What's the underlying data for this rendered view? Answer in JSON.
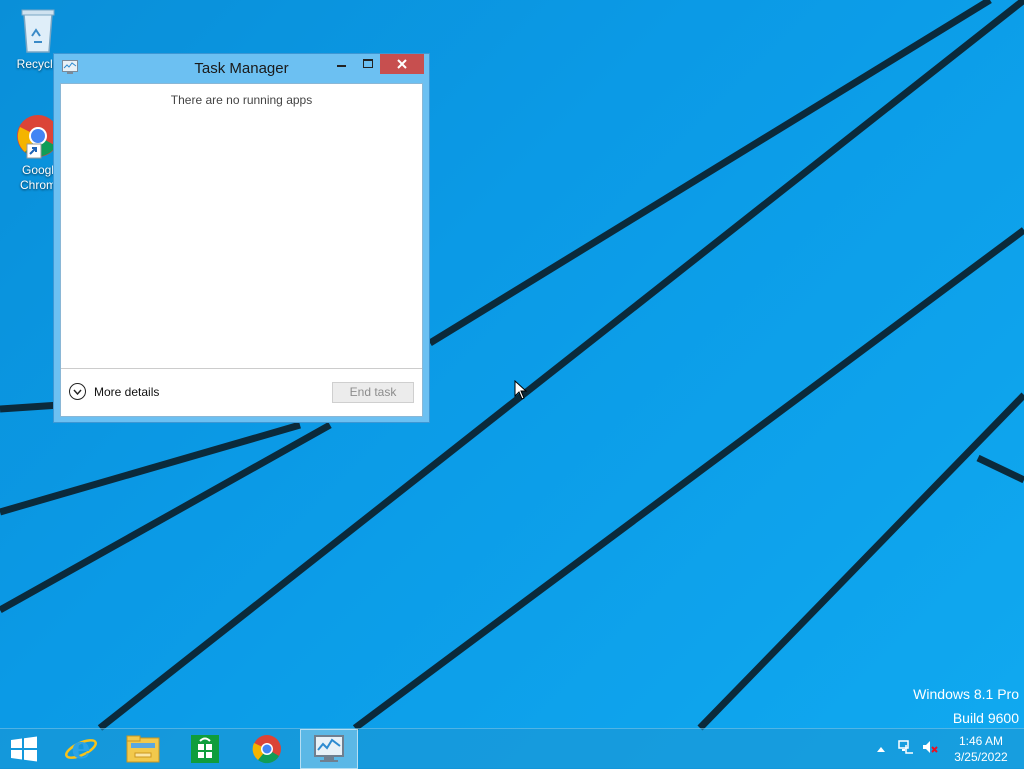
{
  "desktop": {
    "icons": [
      {
        "label": "Recycle",
        "icon": "recycle-bin-icon"
      },
      {
        "label": "Googl\nChrom",
        "icon": "chrome-icon"
      }
    ]
  },
  "window": {
    "title": "Task Manager",
    "empty_message": "There are no running apps",
    "more_details_label": "More details",
    "end_task_label": "End task"
  },
  "watermark": {
    "line1": "Windows 8.1 Pro",
    "line2": "Build 9600"
  },
  "taskbar": {
    "items": [
      "start-icon",
      "internet-explorer-icon",
      "file-explorer-icon",
      "store-icon",
      "chrome-icon",
      "task-manager-icon"
    ],
    "active_item": "task-manager-icon",
    "time": "1:46 AM",
    "date": "3/25/2022"
  },
  "colors": {
    "desktop": "#0b9ae6",
    "window_frame": "#6cc0f2",
    "close_button": "#c74f4f"
  }
}
